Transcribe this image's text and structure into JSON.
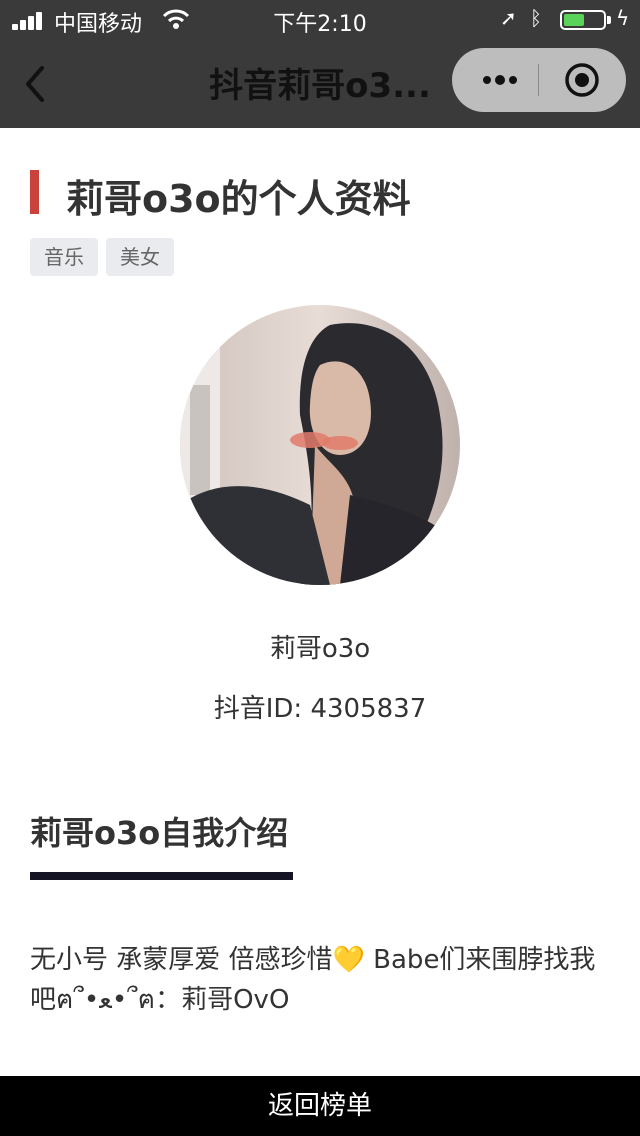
{
  "status_bar": {
    "carrier": "中国移动",
    "time": "下午2:10"
  },
  "nav": {
    "title": "抖音莉哥o3..."
  },
  "profile": {
    "heading": "莉哥o3o的个人资料",
    "tags": [
      "音乐",
      "美女"
    ],
    "name": "莉哥o3o",
    "id_label": "抖音ID: ",
    "id_value": "4305837"
  },
  "intro": {
    "title": "莉哥o3o自我介绍",
    "text": "无小号 承蒙厚爱 倍感珍惜💛 Babe们来围脖找我吧ฅ՞•ﻌ•՞ฅ：莉哥OvO"
  },
  "footer": {
    "button_label": "返回榜单"
  },
  "colors": {
    "accent": "#c9423b",
    "nav_bg": "#3a3a3a",
    "tag_bg": "#e9ebef"
  }
}
